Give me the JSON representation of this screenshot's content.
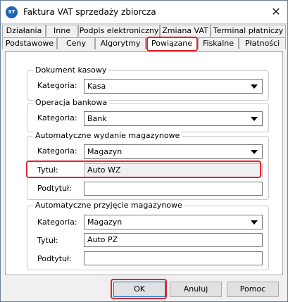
{
  "window": {
    "title": "Faktura VAT sprzedaży zbiorcza",
    "app_icon_text": "ST",
    "close_glyph": "✕"
  },
  "tabs_row1": [
    {
      "label": "Działania"
    },
    {
      "label": "Inne"
    },
    {
      "label": "Podpis elektroniczny"
    },
    {
      "label": "Zmiana VAT"
    },
    {
      "label": "Terminal płatniczy"
    }
  ],
  "tabs_row2": [
    {
      "label": "Podstawowe"
    },
    {
      "label": "Ceny"
    },
    {
      "label": "Algorytmy"
    },
    {
      "label": "Powiązane",
      "active": true
    },
    {
      "label": "Fiskalne"
    },
    {
      "label": "Płatności"
    }
  ],
  "groups": {
    "cash_document": {
      "title": "Dokument kasowy",
      "category_label": "Kategoria:",
      "category_value": "Kasa"
    },
    "bank_operation": {
      "title": "Operacja bankowa",
      "category_label": "Kategoria:",
      "category_value": "Bank"
    },
    "auto_issue": {
      "title": "Automatyczne wydanie magazynowe",
      "category_label": "Kategoria:",
      "category_value": "Magazyn",
      "title_label": "Tytuł:",
      "title_value": "Auto WZ",
      "subtitle_label": "Podtytuł:",
      "subtitle_value": ""
    },
    "auto_receipt": {
      "title": "Automatyczne przyjęcie magazynowe",
      "category_label": "Kategoria:",
      "category_value": "Magazyn",
      "title_label": "Tytuł:",
      "title_value": "Auto PZ",
      "subtitle_label": "Podtytuł:",
      "subtitle_value": ""
    }
  },
  "buttons": {
    "ok": "OK",
    "cancel": "Anuluj",
    "help": "Pomoc"
  },
  "colors": {
    "highlight": "#e0252e",
    "default_button_border": "#0078d7"
  }
}
